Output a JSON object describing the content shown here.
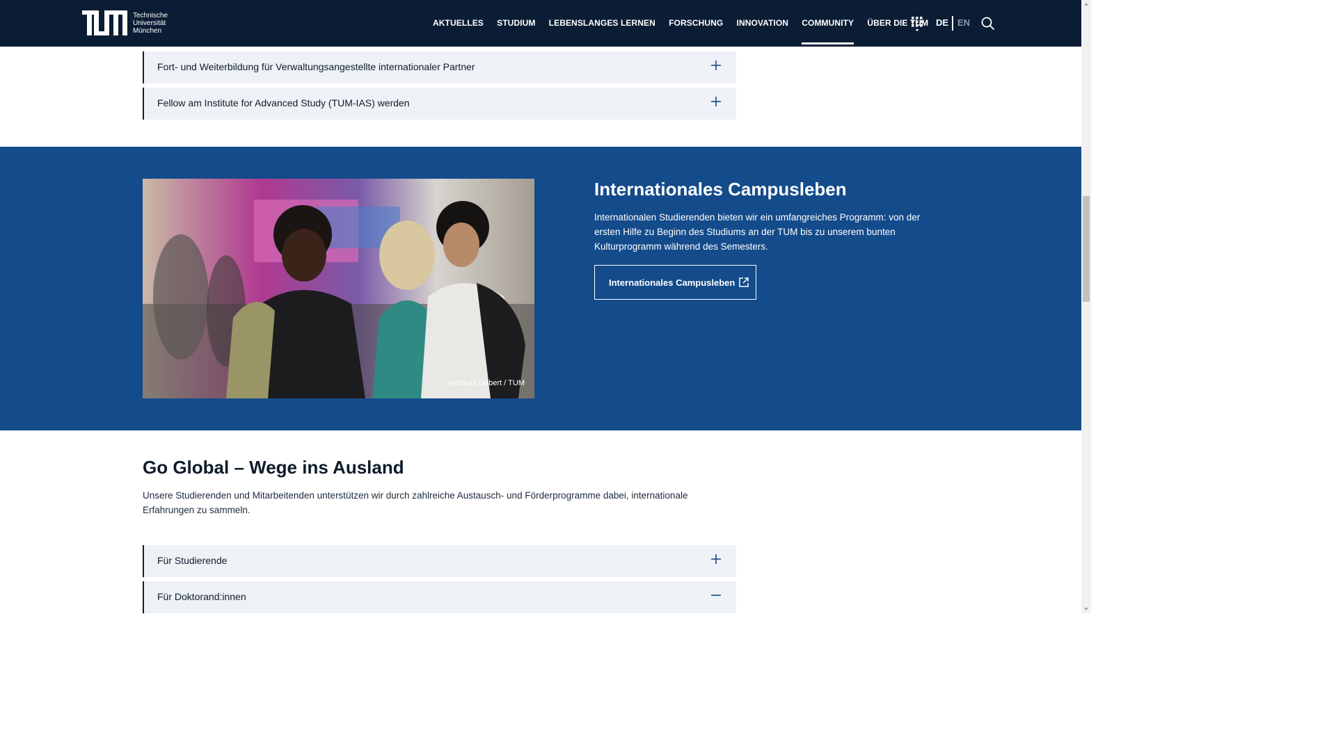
{
  "header": {
    "logo": {
      "mark": "TUM",
      "lines": [
        "Technische",
        "Universität",
        "München"
      ]
    },
    "nav": [
      {
        "label": "AKTUELLES",
        "active": false
      },
      {
        "label": "STUDIUM",
        "active": false
      },
      {
        "label": "LEBENSLANGES LERNEN",
        "active": false
      },
      {
        "label": "FORSCHUNG",
        "active": false
      },
      {
        "label": "INNOVATION",
        "active": false
      },
      {
        "label": "COMMUNITY",
        "active": true
      },
      {
        "label": "ÜBER DIE TUM",
        "active": false
      }
    ],
    "lang_de": "DE",
    "lang_en": "EN",
    "icons": [
      "apps-grid-icon",
      "search-icon"
    ]
  },
  "accordions_top": [
    {
      "label": "Fort- und Weiterbildung für Verwaltungsangestellte internationaler Partner",
      "state": "collapsed"
    },
    {
      "label": "Fellow am Institute for Advanced Study (TUM-IAS) werden",
      "state": "collapsed"
    }
  ],
  "campus": {
    "photo_credit": "Andreas Gebert / TUM",
    "title": "Internationales Campusleben",
    "text": "Internationalen Studierenden bieten wir ein umfangreiches Programm: von der ersten Hilfe zu Beginn des Studiums an der TUM bis zu unserem bunten Kulturprogramm während des Semesters.",
    "button_label": "Internationales Campusleben"
  },
  "go_global": {
    "title": "Go Global – Wege ins Ausland",
    "text": "Unsere Studierenden und Mitarbeitenden unterstützen wir durch zahlreiche Austausch- und Förderprogramme dabei, internationale Erfahrungen zu sammeln.",
    "accordions": [
      {
        "label": "Für Studierende",
        "state": "collapsed"
      },
      {
        "label": "Für Doktorand:innen",
        "state": "expanded"
      }
    ]
  },
  "colors": {
    "header_bg": "#0b1d34",
    "band_bg": "#144b8b",
    "accordion_bg": "#eef2f6",
    "accent": "#144b8b"
  }
}
